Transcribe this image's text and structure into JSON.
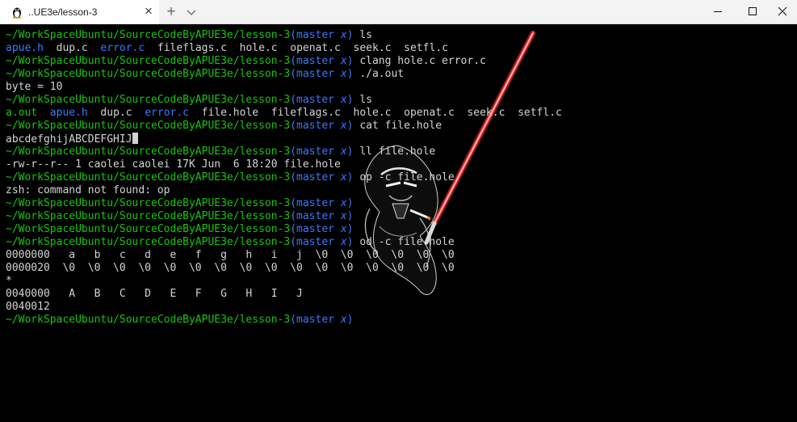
{
  "window": {
    "tab_title": "..UE3e/lesson-3",
    "tab_icon": "linux-tux-icon",
    "new_tab_glyph": "+",
    "close_glyph": "×"
  },
  "colors": {
    "path": "#16c60c",
    "git": "#3b78ff",
    "text": "#d4d4d4",
    "background": "#000000"
  },
  "prompt": {
    "path": "~/WorkSpaceUbuntu/SourceCodeByAPUE3e/lesson-3",
    "git_open": "(",
    "branch": "master",
    "dirty": "x",
    "git_close": ")"
  },
  "terminal": {
    "line0_cmd": "ls",
    "ls1": {
      "a": "apue.h",
      "b": "dup.c",
      "c": "error.c",
      "d": "fileflags.c",
      "e": "hole.c",
      "f": "openat.c",
      "g": "seek.c",
      "h": "setfl.c"
    },
    "line2_cmd": "clang hole.c error.c",
    "line3_cmd": "./a.out",
    "line4_out": "byte = 10",
    "line5_cmd": "ls",
    "ls2": {
      "a": "a.out",
      "b": "apue.h",
      "c": "dup.c",
      "d": "error.c",
      "e": "file.hole",
      "f": "fileflags.c",
      "g": "hole.c",
      "h": "openat.c",
      "i": "seek.c",
      "j": "setfl.c"
    },
    "line7_cmd": "cat file.hole",
    "line8_out": "abcdefghijABCDEFGHIJ",
    "line9_cmd": "ll file.hole",
    "line10_out": "-rw-r--r-- 1 caolei caolei 17K Jun  6 18:20 file.hole",
    "line11_cmd": "op -c file.hole",
    "line12_out": "zsh: command not found: op",
    "line16_cmd": "od -c file.hole",
    "line17_out": "0000000   a   b   c   d   e   f   g   h   i   j  \\0  \\0  \\0  \\0  \\0  \\0",
    "line18_out": "0000020  \\0  \\0  \\0  \\0  \\0  \\0  \\0  \\0  \\0  \\0  \\0  \\0  \\0  \\0  \\0  \\0",
    "line19_out": "*",
    "line20_out": "0040000   A   B   C   D   E   F   G   H   I   J",
    "line21_out": "0040012"
  }
}
